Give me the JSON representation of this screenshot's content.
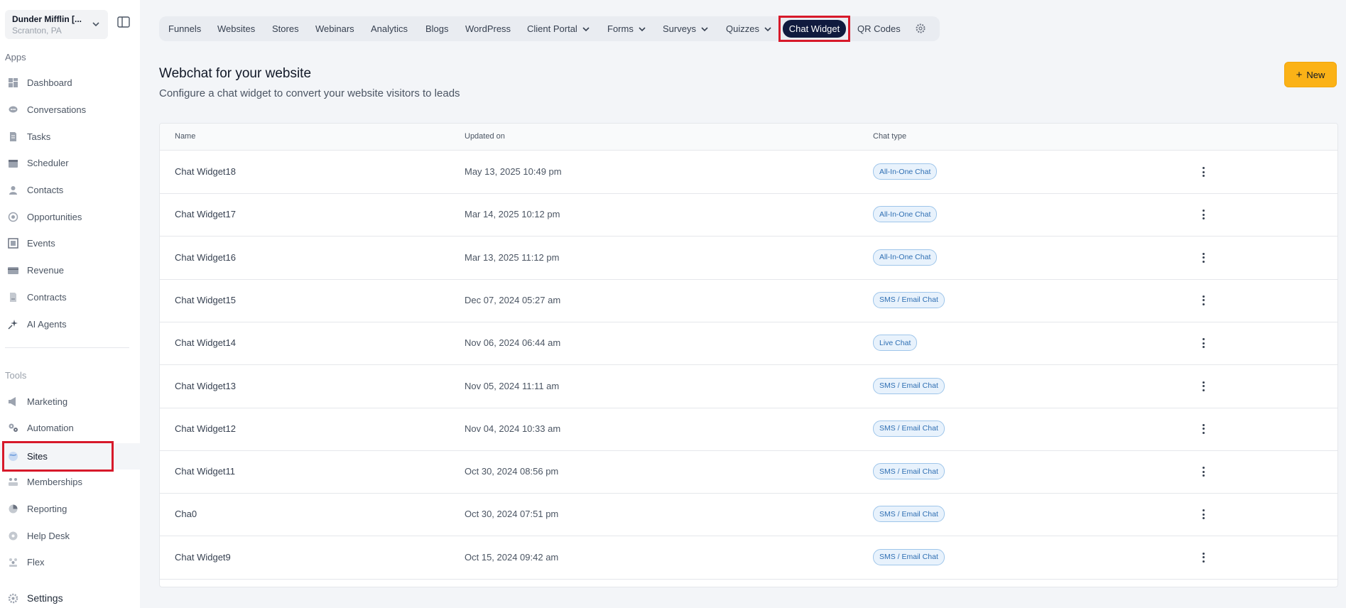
{
  "account": {
    "name": "Dunder Mifflin [...",
    "location": "Scranton, PA"
  },
  "sidebar": {
    "apps_label": "Apps",
    "apps": [
      {
        "label": "Dashboard",
        "icon": "dashboard-icon"
      },
      {
        "label": "Conversations",
        "icon": "chat-icon"
      },
      {
        "label": "Tasks",
        "icon": "document-icon"
      },
      {
        "label": "Scheduler",
        "icon": "calendar-icon"
      },
      {
        "label": "Contacts",
        "icon": "person-icon"
      },
      {
        "label": "Opportunities",
        "icon": "target-icon"
      },
      {
        "label": "Events",
        "icon": "events-icon"
      },
      {
        "label": "Revenue",
        "icon": "card-icon"
      },
      {
        "label": "Contracts",
        "icon": "contract-icon"
      },
      {
        "label": "AI Agents",
        "icon": "sparkle-icon"
      }
    ],
    "tools_label": "Tools",
    "tools": [
      {
        "label": "Marketing",
        "icon": "megaphone-icon"
      },
      {
        "label": "Automation",
        "icon": "gears-icon"
      },
      {
        "label": "Sites",
        "icon": "globe-icon",
        "active": true
      },
      {
        "label": "Memberships",
        "icon": "people-icon"
      },
      {
        "label": "Reporting",
        "icon": "pie-icon"
      },
      {
        "label": "Help Desk",
        "icon": "help-icon"
      },
      {
        "label": "Flex",
        "icon": "group-icon"
      }
    ],
    "settings_label": "Settings"
  },
  "topnav": {
    "tabs": [
      {
        "label": "Funnels"
      },
      {
        "label": "Websites"
      },
      {
        "label": "Stores"
      },
      {
        "label": "Webinars"
      },
      {
        "label": "Analytics"
      },
      {
        "label": "Blogs"
      },
      {
        "label": "WordPress"
      },
      {
        "label": "Client Portal",
        "dropdown": true
      },
      {
        "label": "Forms",
        "dropdown": true
      },
      {
        "label": "Surveys",
        "dropdown": true
      },
      {
        "label": "Quizzes",
        "dropdown": true
      },
      {
        "label": "Chat Widget",
        "active": true
      },
      {
        "label": "QR Codes"
      }
    ]
  },
  "header": {
    "title": "Webchat for your website",
    "subtitle": "Configure a chat widget to convert your website visitors to leads",
    "new_button": "New"
  },
  "table": {
    "columns": {
      "name": "Name",
      "updated": "Updated on",
      "type": "Chat type"
    },
    "rows": [
      {
        "name": "Chat Widget18",
        "updated": "May 13, 2025 10:49 pm",
        "type": "All-In-One Chat"
      },
      {
        "name": "Chat Widget17",
        "updated": "Mar 14, 2025 10:12 pm",
        "type": "All-In-One Chat"
      },
      {
        "name": "Chat Widget16",
        "updated": "Mar 13, 2025 11:12 pm",
        "type": "All-In-One Chat"
      },
      {
        "name": "Chat Widget15",
        "updated": "Dec 07, 2024 05:27 am",
        "type": "SMS / Email Chat"
      },
      {
        "name": "Chat Widget14",
        "updated": "Nov 06, 2024 06:44 am",
        "type": "Live Chat"
      },
      {
        "name": "Chat Widget13",
        "updated": "Nov 05, 2024 11:11 am",
        "type": "SMS / Email Chat"
      },
      {
        "name": "Chat Widget12",
        "updated": "Nov 04, 2024 10:33 am",
        "type": "SMS / Email Chat"
      },
      {
        "name": "Chat Widget11",
        "updated": "Oct 30, 2024 08:56 pm",
        "type": "SMS / Email Chat"
      },
      {
        "name": "Cha0",
        "updated": "Oct 30, 2024 07:51 pm",
        "type": "SMS / Email Chat"
      },
      {
        "name": "Chat Widget9",
        "updated": "Oct 15, 2024 09:42 am",
        "type": "SMS / Email Chat"
      }
    ]
  },
  "colors": {
    "accent": "#fbb217",
    "active_tab": "#101a3e",
    "highlight": "#d7192a",
    "badge": "#2f6fb3"
  }
}
